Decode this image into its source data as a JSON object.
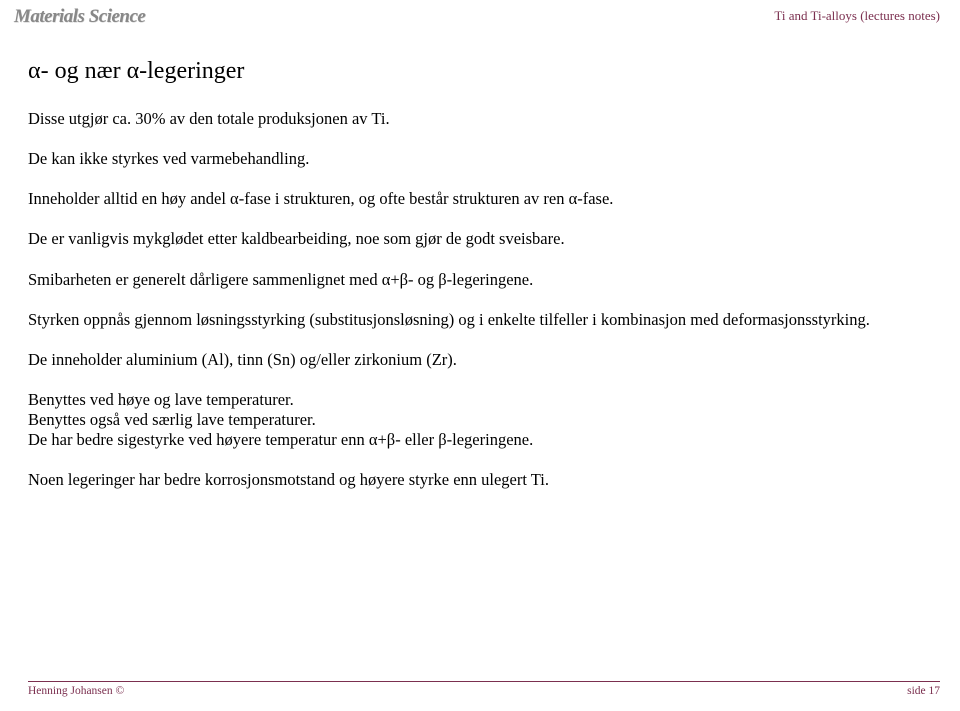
{
  "header": {
    "left": "Materials Science",
    "right": "Ti and Ti-alloys (lectures notes)"
  },
  "title": "α- og nær α-legeringer",
  "paragraphs": {
    "p1": "Disse utgjør ca. 30% av den totale produksjonen av Ti.",
    "p2": "De kan ikke styrkes ved varmebehandling.",
    "p3": "Inneholder alltid en høy andel α-fase i strukturen, og ofte består strukturen av ren α-fase.",
    "p4": "De er vanligvis mykglødet etter kaldbearbeiding, noe som gjør de godt sveisbare.",
    "p5": "Smibarheten er generelt dårligere sammenlignet med α+β- og β-legeringene.",
    "p6": "Styrken oppnås gjennom løsningsstyrking (substitusjonsløsning) og i enkelte tilfeller i kombinasjon med deformasjonsstyrking.",
    "p7": "De inneholder aluminium (Al), tinn (Sn) og/eller zirkonium (Zr).",
    "p8a": "Benyttes ved høye og lave temperaturer.",
    "p8b": "Benyttes også ved særlig lave temperaturer.",
    "p8c": "De har bedre sigestyrke ved høyere temperatur enn α+β- eller β-legeringene.",
    "p9": "Noen legeringer har bedre korrosjonsmotstand og høyere styrke enn ulegert Ti."
  },
  "footer": {
    "left": "Henning Johansen ©",
    "right": "side 17"
  }
}
